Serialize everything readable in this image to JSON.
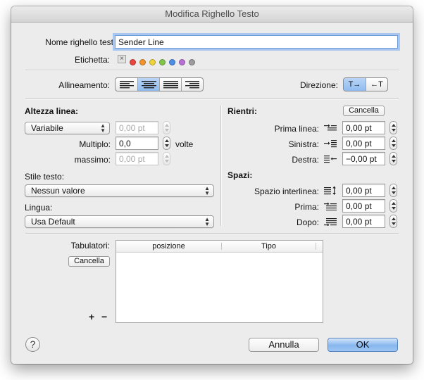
{
  "window": {
    "title": "Modifica Righello Testo"
  },
  "ruler_name": {
    "label": "Nome righello testo:",
    "value": "Sender Line"
  },
  "label_tag": {
    "label": "Etichetta:",
    "colors": [
      "#e8463e",
      "#f2952e",
      "#efd33a",
      "#7fc64a",
      "#4d8ee6",
      "#b86fd6",
      "#9c9c9c"
    ]
  },
  "alignment": {
    "label": "Allineamento:",
    "selected_index": 1
  },
  "direction": {
    "label": "Direzione:",
    "options": [
      "T→",
      "←T"
    ],
    "selected_index": 0
  },
  "line_height": {
    "heading": "Altezza linea:",
    "mode": "Variabile",
    "fixed_value": "0,00 pt",
    "multiple_label": "Multiplo:",
    "multiple_value": "0,0",
    "multiple_unit": "volte",
    "max_label": "massimo:",
    "max_value": "0,00 pt"
  },
  "text_style": {
    "label": "Stile testo:",
    "value": "Nessun valore"
  },
  "language": {
    "label": "Lingua:",
    "value": "Usa Default"
  },
  "indents": {
    "heading": "Rientri:",
    "cancel_label": "Cancella",
    "first_line_label": "Prima linea:",
    "first_line_value": "0,00 pt",
    "left_label": "Sinistra:",
    "left_value": "0,00 pt",
    "right_label": "Destra:",
    "right_value": "−0,00 pt"
  },
  "spacing": {
    "heading": "Spazi:",
    "line_spacing_label": "Spazio interlinea:",
    "line_spacing_value": "0,00 pt",
    "before_label": "Prima:",
    "before_value": "0,00 pt",
    "after_label": "Dopo:",
    "after_value": "0,00 pt"
  },
  "tabs": {
    "label": "Tabulatori:",
    "cancel_label": "Cancella",
    "columns": [
      "posizione",
      "Tipo"
    ],
    "add_label": "+",
    "remove_label": "−"
  },
  "footer": {
    "help_label": "?",
    "cancel_label": "Annulla",
    "ok_label": "OK"
  }
}
